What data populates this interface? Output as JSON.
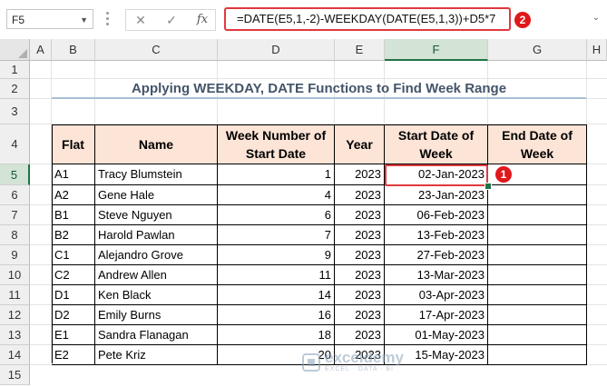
{
  "formula_bar": {
    "name_box": "F5",
    "cancel_glyph": "✕",
    "enter_glyph": "✓",
    "fx_label": "fx",
    "formula": "=DATE(E5,1,-2)-WEEKDAY(DATE(E5,1,3))+D5*7",
    "badge": "2"
  },
  "columns": [
    "A",
    "B",
    "C",
    "D",
    "E",
    "F",
    "G",
    "H"
  ],
  "rows": [
    "1",
    "2",
    "3",
    "4",
    "5",
    "6",
    "7",
    "8",
    "9",
    "10",
    "11",
    "12",
    "13",
    "14",
    "15"
  ],
  "title": "Applying WEEKDAY, DATE Functions to Find Week Range",
  "headers": [
    "Flat",
    "Name",
    "Week Number of Start Date",
    "Year",
    "Start Date of Week",
    "End Date of Week"
  ],
  "table": [
    [
      "A1",
      "Tracy Blumstein",
      "1",
      "2023",
      "02-Jan-2023",
      ""
    ],
    [
      "A2",
      "Gene Hale",
      "4",
      "2023",
      "23-Jan-2023",
      ""
    ],
    [
      "B1",
      "Steve Nguyen",
      "6",
      "2023",
      "06-Feb-2023",
      ""
    ],
    [
      "B2",
      "Harold Pawlan",
      "7",
      "2023",
      "13-Feb-2023",
      ""
    ],
    [
      "C1",
      "Alejandro Grove",
      "9",
      "2023",
      "27-Feb-2023",
      ""
    ],
    [
      "C2",
      "Andrew Allen",
      "11",
      "2023",
      "13-Mar-2023",
      ""
    ],
    [
      "D1",
      "Ken Black",
      "14",
      "2023",
      "03-Apr-2023",
      ""
    ],
    [
      "D2",
      "Emily Burns",
      "16",
      "2023",
      "17-Apr-2023",
      ""
    ],
    [
      "E1",
      "Sandra Flanagan",
      "18",
      "2023",
      "01-May-2023",
      ""
    ],
    [
      "E2",
      "Pete Kriz",
      "20",
      "2023",
      "15-May-2023",
      ""
    ]
  ],
  "cell_badge": "1",
  "selected_cell": "F5",
  "watermark": {
    "name": "exceldemy",
    "tagline": "EXCEL · DATA · BI"
  },
  "colors": {
    "accent": "#e0393e",
    "header_fill": "#fce4d6",
    "title_text": "#44546a",
    "selection": "#217346"
  }
}
